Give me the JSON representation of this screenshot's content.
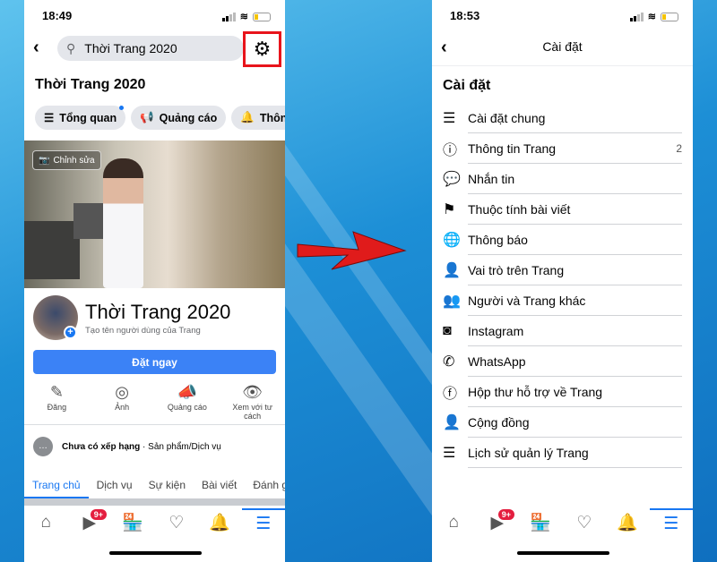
{
  "left": {
    "status": {
      "time": "18:49"
    },
    "search": {
      "value": "Thời Trang 2020"
    },
    "page_title": "Thời Trang 2020",
    "chips": [
      {
        "label": "Tổng quan",
        "icon": "list-icon"
      },
      {
        "label": "Quảng cáo",
        "icon": "megaphone-icon"
      },
      {
        "label": "Thông bá",
        "icon": "bell-icon"
      }
    ],
    "cover": {
      "edit_label": "Chỉnh sửa"
    },
    "profile": {
      "name": "Thời Trang 2020",
      "subtitle": "Tạo tên người dùng của Trang"
    },
    "cta_label": "Đặt ngay",
    "actions": [
      {
        "label": "Đăng",
        "icon": "edit-icon"
      },
      {
        "label": "Ảnh",
        "icon": "camera-icon"
      },
      {
        "label": "Quảng cáo",
        "icon": "megaphone-icon"
      },
      {
        "label": "Xem với tư cách",
        "icon": "eye-icon"
      }
    ],
    "rating": {
      "text": "Chưa có xếp hạng",
      "category": "Sản phẩm/Dịch vụ"
    },
    "tabs": [
      "Trang chủ",
      "Dịch vụ",
      "Sự kiện",
      "Bài viết",
      "Đánh g"
    ],
    "nav_badge": "9+"
  },
  "right": {
    "status": {
      "time": "18:53"
    },
    "header_title": "Cài đặt",
    "section_title": "Cài đặt",
    "items": [
      {
        "label": "Cài đặt chung",
        "icon": "settings-list-icon",
        "glyph": "☰"
      },
      {
        "label": "Thông tin Trang",
        "icon": "info-icon",
        "glyph": "ⓘ",
        "count": "2"
      },
      {
        "label": "Nhắn tin",
        "icon": "chat-icon",
        "glyph": "💬"
      },
      {
        "label": "Thuộc tính bài viết",
        "icon": "flag-icon",
        "glyph": "⚑"
      },
      {
        "label": "Thông báo",
        "icon": "globe-icon",
        "glyph": "🌐"
      },
      {
        "label": "Vai trò trên Trang",
        "icon": "person-icon",
        "glyph": "👤"
      },
      {
        "label": "Người và Trang khác",
        "icon": "group-icon",
        "glyph": "👥"
      },
      {
        "label": "Instagram",
        "icon": "instagram-icon",
        "glyph": "◙"
      },
      {
        "label": "WhatsApp",
        "icon": "whatsapp-icon",
        "glyph": "✆"
      },
      {
        "label": "Hộp thư hỗ trợ về Trang",
        "icon": "facebook-icon",
        "glyph": "ⓕ"
      },
      {
        "label": "Cộng đồng",
        "icon": "person-icon",
        "glyph": "👤"
      },
      {
        "label": "Lịch sử quản lý Trang",
        "icon": "settings-list-icon",
        "glyph": "☰"
      }
    ],
    "nav_badge": "9+"
  },
  "colors": {
    "accent": "#1877f2",
    "highlight": "#e8141b",
    "arrow": "#e01b1b",
    "background": "#1d8fd6"
  }
}
